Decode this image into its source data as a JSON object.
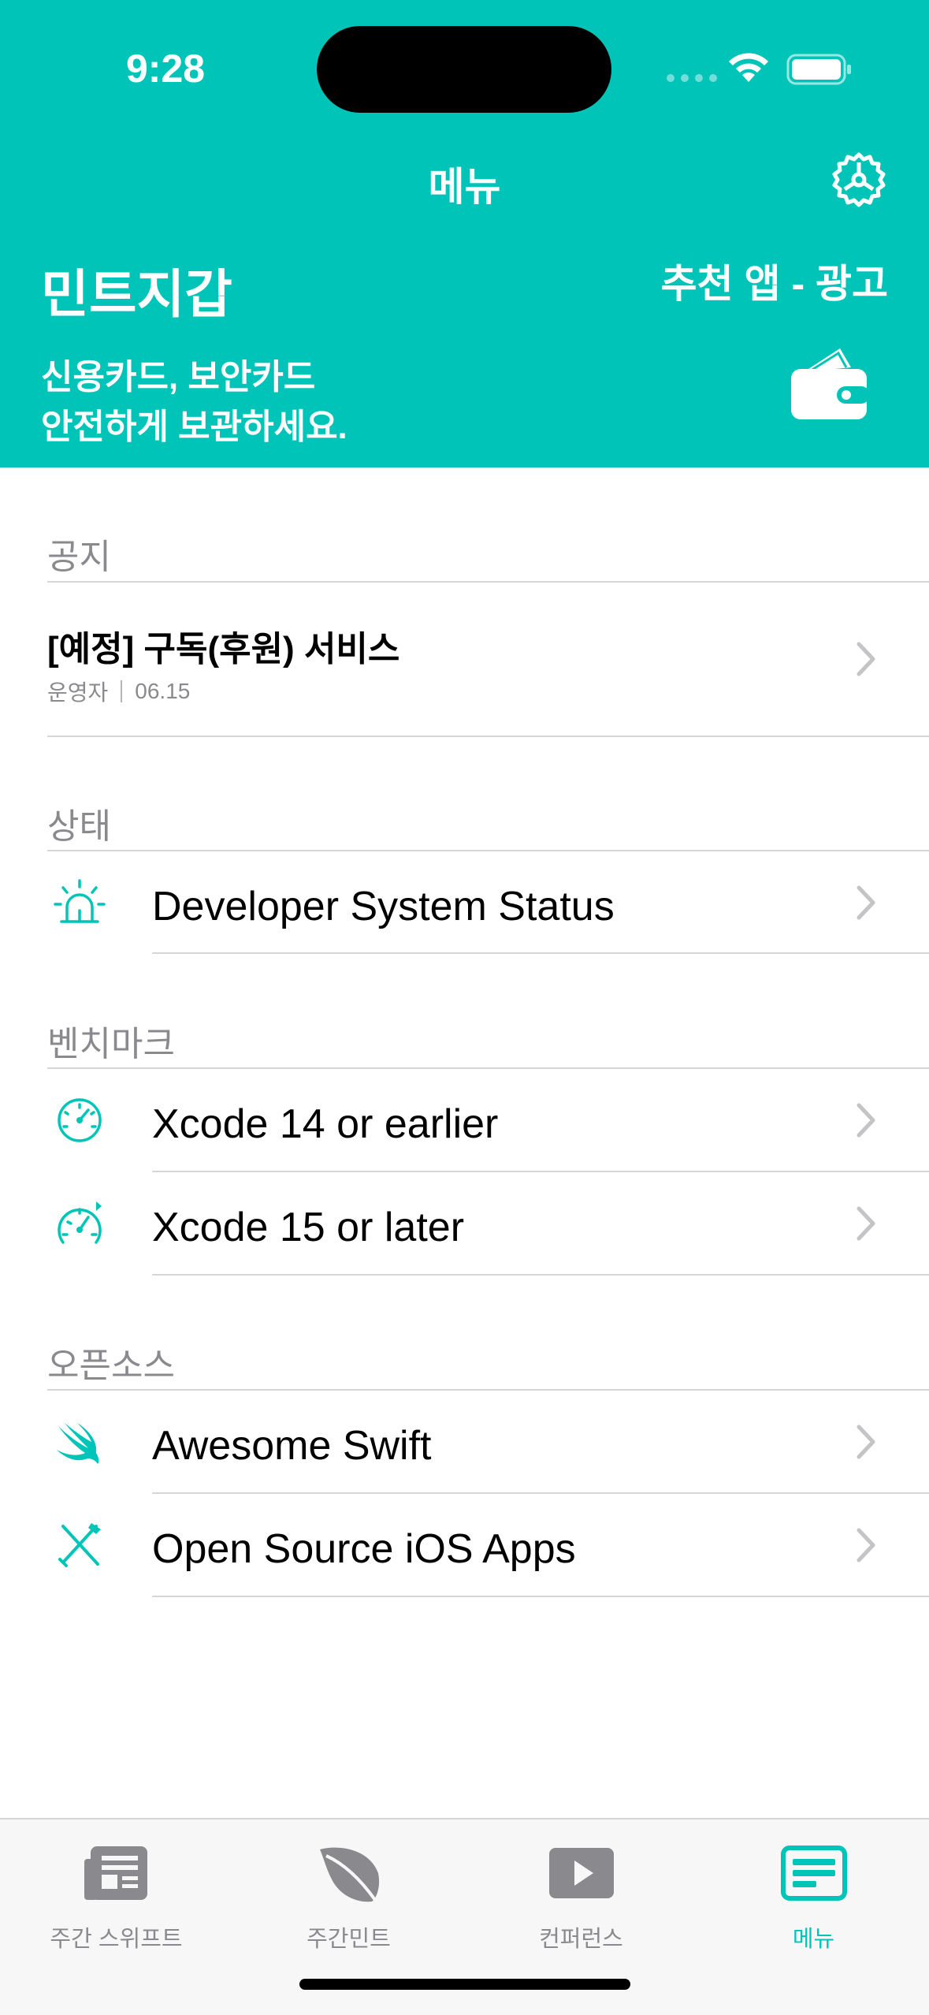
{
  "colors": {
    "accent": "#00c4b8",
    "secondary_text": "#8a8a8e",
    "tab_inactive": "#8a8a8e"
  },
  "status_bar": {
    "time": "9:28"
  },
  "nav": {
    "title": "메뉴",
    "settings_icon": "gear-icon"
  },
  "promo": {
    "app_name": "민트지갑",
    "ad_label": "추천 앱 - 광고",
    "line1": "신용카드, 보안카드",
    "line2": "안전하게 보관하세요.",
    "icon": "wallet-icon"
  },
  "sections": {
    "notice": {
      "header": "공지",
      "title": "[예정] 구독(후원) 서비스",
      "author": "운영자",
      "date": "06.15"
    },
    "status": {
      "header": "상태",
      "items": [
        {
          "label": "Developer System Status",
          "icon": "alarm-light-icon"
        }
      ]
    },
    "benchmark": {
      "header": "벤치마크",
      "items": [
        {
          "label": "Xcode 14 or earlier",
          "icon": "gauge-icon"
        },
        {
          "label": "Xcode 15 or later",
          "icon": "speedometer-icon"
        }
      ]
    },
    "opensource": {
      "header": "오픈소스",
      "items": [
        {
          "label": "Awesome Swift",
          "icon": "swift-icon"
        },
        {
          "label": "Open Source iOS Apps",
          "icon": "tools-icon"
        }
      ]
    }
  },
  "tabs": [
    {
      "label": "주간 스위프트",
      "icon": "newspaper-icon",
      "active": false
    },
    {
      "label": "주간민트",
      "icon": "leaf-icon",
      "active": false
    },
    {
      "label": "컨퍼런스",
      "icon": "play-icon",
      "active": false
    },
    {
      "label": "메뉴",
      "icon": "menu-card-icon",
      "active": true
    }
  ]
}
